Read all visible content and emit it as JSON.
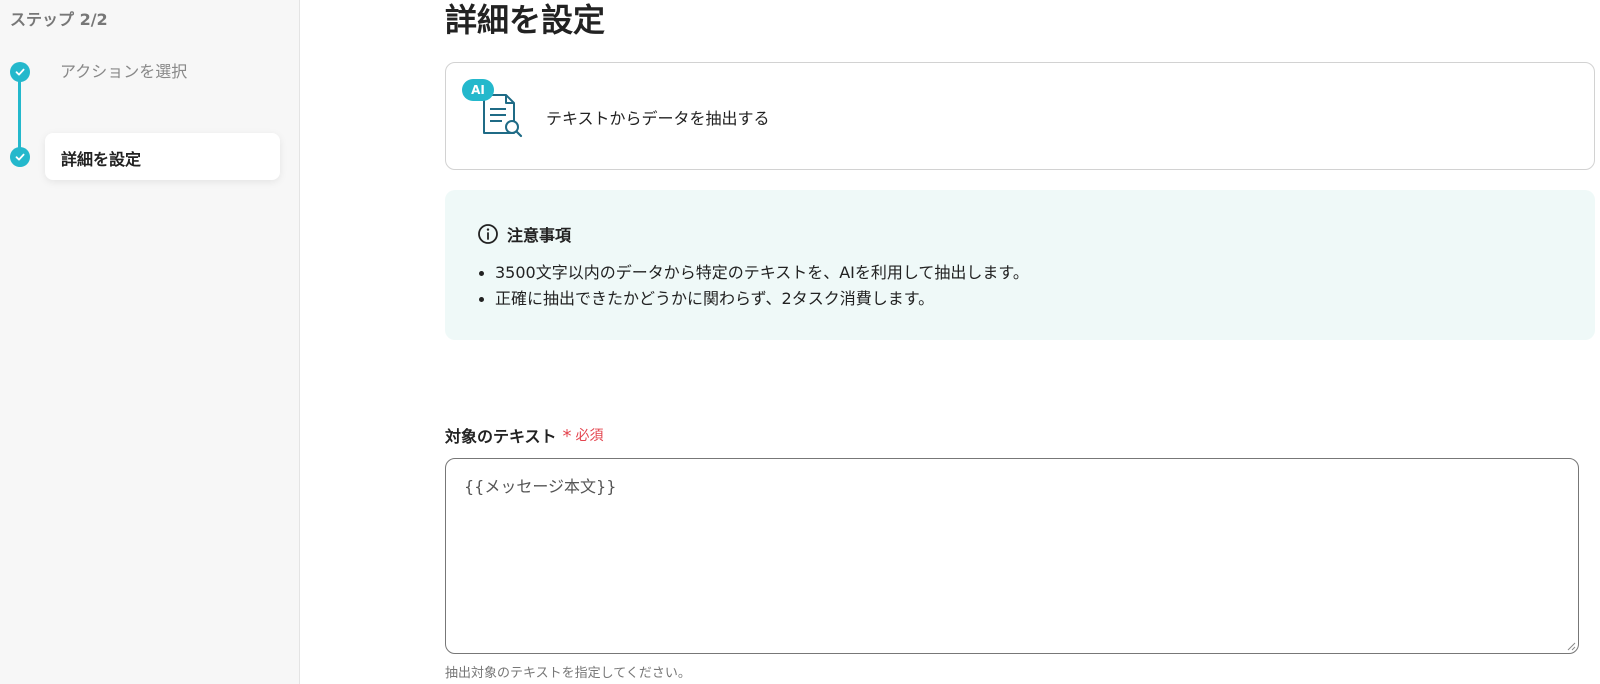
{
  "sidebar": {
    "step_count": "ステップ 2/2",
    "steps": [
      {
        "label": "アクションを選択",
        "state": "done"
      },
      {
        "label": "詳細を設定",
        "state": "current"
      }
    ]
  },
  "main": {
    "title": "詳細を設定",
    "action": {
      "badge": "AI",
      "label": "テキストからデータを抽出する",
      "icon": "document-search-icon"
    },
    "notice": {
      "icon": "info-icon",
      "title": "注意事項",
      "items": [
        "3500文字以内のデータから特定のテキストを、AIを利用して抽出します。",
        "正確に抽出できたかどうかに関わらず、2タスク消費します。"
      ]
    },
    "field": {
      "label": "対象のテキスト",
      "required_mark": "*",
      "required_text": "必須",
      "value": "{{メッセージ本文}}",
      "hint": "抽出対象のテキストを指定してください。"
    }
  },
  "colors": {
    "accent": "#24b8cc",
    "notice_bg": "#eff9f8",
    "required": "#e4454f",
    "sidebar_bg": "#f7f7f7"
  }
}
